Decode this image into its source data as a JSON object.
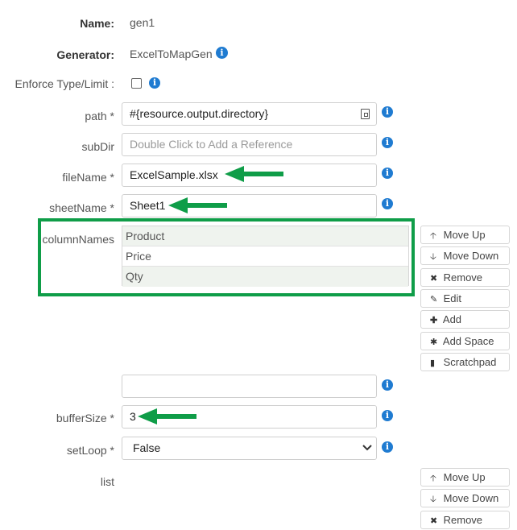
{
  "form": {
    "name_label": "Name:",
    "name_value": "gen1",
    "generator_label": "Generator:",
    "generator_value": "ExcelToMapGen",
    "enforce_label": "Enforce Type/Limit :",
    "path_label": "path *",
    "path_value": "#{resource.output.directory}",
    "subdir_label": "subDir",
    "subdir_placeholder": "Double Click to Add a Reference",
    "filename_label": "fileName *",
    "filename_value": "ExcelSample.xlsx",
    "sheetname_label": "sheetName *",
    "sheetname_value": "Sheet1",
    "columnnames_label": "columnNames",
    "columnnames_items": [
      "Product",
      "Price",
      "Qty"
    ],
    "buffersize_label": "bufferSize *",
    "buffersize_value": "3",
    "setloop_label": "setLoop *",
    "setloop_value": "False",
    "list_label": "list"
  },
  "column_buttons": {
    "move_up": "Move Up",
    "move_down": "Move Down",
    "remove": "Remove",
    "edit": "Edit",
    "add": "Add",
    "add_space": "Add Space",
    "scratchpad": "Scratchpad"
  },
  "list_buttons": {
    "move_up": "Move Up",
    "move_down": "Move Down",
    "remove": "Remove"
  },
  "colors": {
    "accent_green": "#0f9d48",
    "info_blue": "#1f7bd1"
  },
  "icons": [
    "info-icon",
    "arrow-up-icon",
    "arrow-down-icon",
    "close-icon",
    "pencil-icon",
    "plus-icon",
    "asterisk-icon",
    "file-icon",
    "chevron-down-icon",
    "green-arrow-annotation"
  ]
}
